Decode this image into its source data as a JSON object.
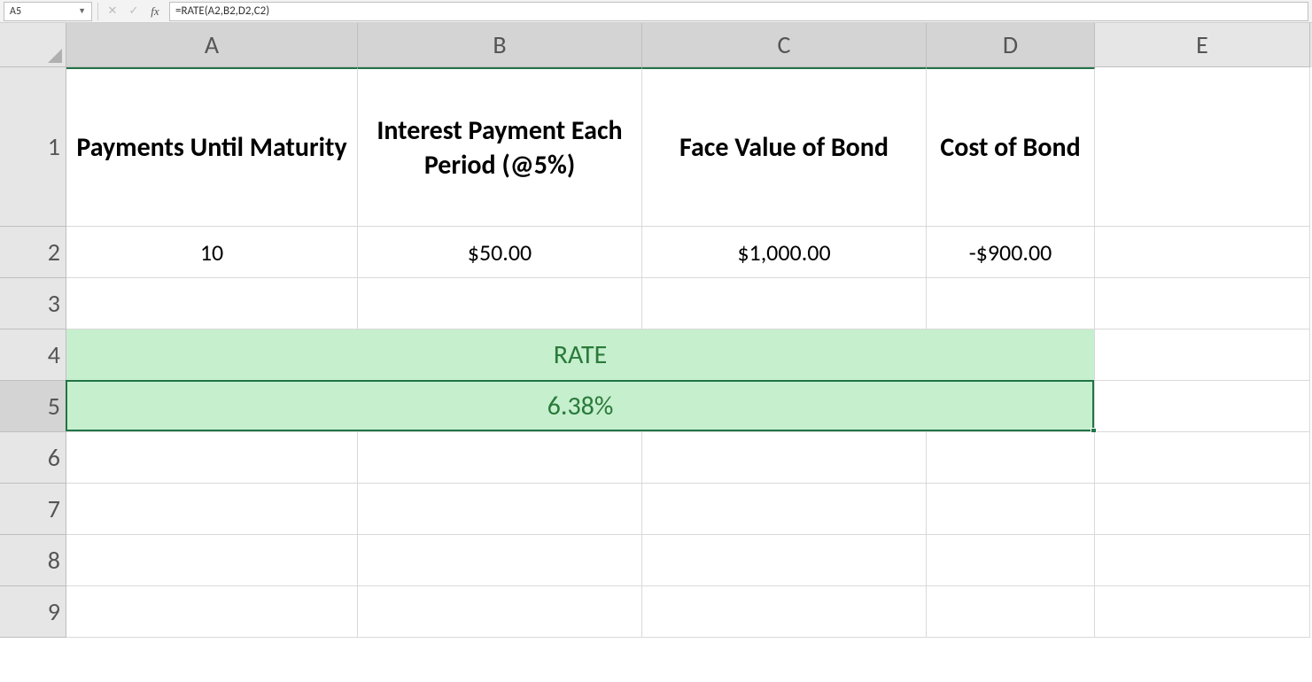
{
  "formulaBar": {
    "nameBox": "A5",
    "formula": "=RATE(A2,B2,D2,C2)"
  },
  "columnHeaders": [
    "A",
    "B",
    "C",
    "D",
    "E"
  ],
  "rowHeaders": [
    "1",
    "2",
    "3",
    "4",
    "5",
    "6",
    "7",
    "8",
    "9"
  ],
  "headers": {
    "A": "Payments Until Maturity",
    "B": "Interest Payment Each Period (@5%)",
    "C": "Face Value of Bond",
    "D": "Cost of Bond"
  },
  "row2": {
    "A": "10",
    "B": "$50.00",
    "C": "$1,000.00",
    "D": "-$900.00"
  },
  "row4": {
    "merged": "RATE"
  },
  "row5": {
    "merged": "6.38%"
  },
  "selectedCell": "A5"
}
